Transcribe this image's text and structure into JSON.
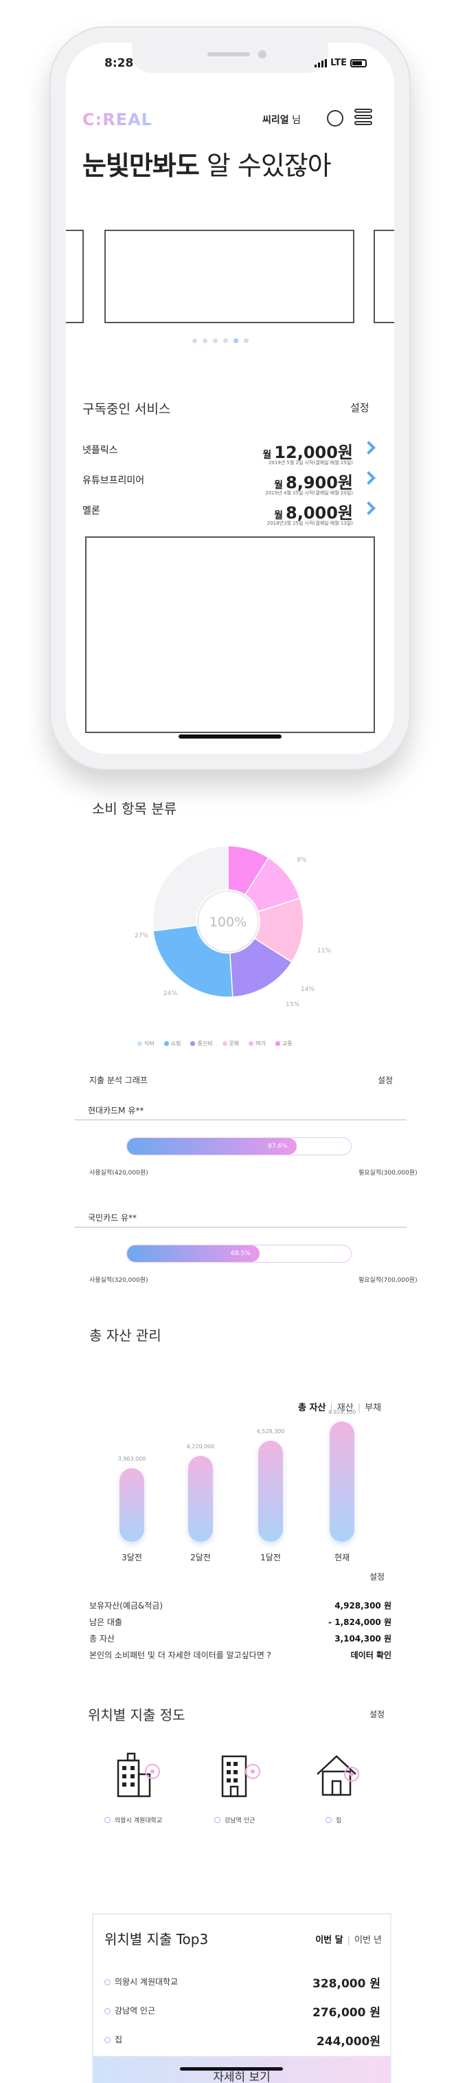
{
  "status": {
    "time": "8:28",
    "network": "LTE"
  },
  "header": {
    "logo": "C:REAL",
    "user_name": "씨리얼",
    "user_suffix": " 님",
    "headline_bold": "눈빛만봐도",
    "headline_light": " 알 수있잖아"
  },
  "subscriptions": {
    "title": "구독중인 서비스",
    "settings_label": "설정",
    "items": [
      {
        "name": "넷플릭스",
        "unit": "월",
        "price": "12,000원",
        "note": "2019년 5월 2일 시작(결제일 매월 25일)"
      },
      {
        "name": "유튜브프리미어",
        "unit": "월",
        "price": "8,900원",
        "note": "2019년 4월 25일 시작(결제일 매월 20일)"
      },
      {
        "name": "멜론",
        "unit": "월",
        "price": "8,000원",
        "note": "2018년3월 25일 시작(결제일 매월 13일)"
      }
    ]
  },
  "consumption": {
    "title": "소비 항목 분류",
    "center_label": "100%",
    "chart_data": {
      "type": "pie",
      "categories": [
        "식비",
        "쇼핑",
        "통신비",
        "문화",
        "여가",
        "교통"
      ],
      "values": [
        27,
        24,
        15,
        14,
        11,
        9
      ],
      "colors": [
        "#f3f3f5",
        "#6db8f8",
        "#a58ef5",
        "#ffc0e4",
        "#ffb0f4",
        "#fb8cf2"
      ]
    },
    "pct_labels": [
      "9%",
      "11%",
      "14%",
      "15%",
      "24%",
      "27%"
    ]
  },
  "spending": {
    "title": "지출 분석 그래프",
    "settings_label": "설정",
    "cards": [
      {
        "name": "현대카드M 유**",
        "percent": 87.6,
        "percent_label": "87.6%",
        "used": "사용실적(420,000원)",
        "target": "필요실적(300,000원)"
      },
      {
        "name": "국민카드 유**",
        "percent": 68.5,
        "percent_label": "68.5%",
        "used": "사용실적(320,000원)",
        "target": "필요실적(700,000원)"
      }
    ]
  },
  "assets": {
    "title": "총 자산 관리",
    "tabs": [
      "총 자산",
      "재산",
      "부채"
    ],
    "chart_data": {
      "type": "bar",
      "categories": [
        "3달전",
        "2달전",
        "1달전",
        "현재"
      ],
      "values": [
        3963000,
        4220000,
        4528300,
        4928300
      ],
      "value_labels": [
        "3,963,000",
        "4,220,000",
        "4,528,300",
        "4,928,300"
      ]
    },
    "settings_label": "설정",
    "summary": [
      {
        "label": "보유자산(예금&적금)",
        "value": "4,928,300 원"
      },
      {
        "label": "남은 대출",
        "value": "- 1,824,000 원"
      },
      {
        "label": "총 자산",
        "value": "3,104,300 원"
      },
      {
        "label": "본인의 소비패턴 및 더 자세한 데이터를 알고싶다면 ?",
        "value": "데이터 확인"
      }
    ]
  },
  "location": {
    "title": "위치별 지출 정도",
    "settings_label": "설정",
    "places": [
      "의왕시 계원대학교",
      "강남역 인근",
      "집"
    ],
    "top3": {
      "title": "위치별 지출 Top3",
      "tabs": [
        "이번 달",
        "이번 년"
      ],
      "rows": [
        {
          "name": "의왕시 계원대학교",
          "value": "328,000 원"
        },
        {
          "name": "강남역 인근",
          "value": "276,000 원"
        },
        {
          "name": "집",
          "value": "244,000원"
        }
      ],
      "detail_label": "자세히 보기"
    }
  }
}
